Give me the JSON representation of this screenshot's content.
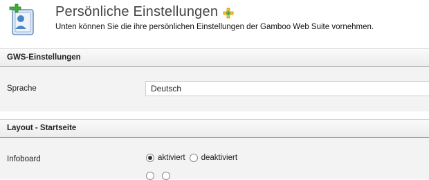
{
  "header": {
    "title": "Persönliche Einstellungen",
    "subtitle": "Unten können Sie die ihre persönlichen Einstellungen der Gamboo Web Suite vornehmen.",
    "icon": "user-settings-icon",
    "add_icon": "add-plus-icon"
  },
  "sections": [
    {
      "title": "GWS-Einstellungen",
      "fields": [
        {
          "label": "Sprache",
          "type": "select",
          "value": "Deutsch"
        }
      ]
    },
    {
      "title": "Layout - Startseite",
      "fields": [
        {
          "label": "Infoboard",
          "type": "radio",
          "options": [
            "aktiviert",
            "deaktiviert"
          ],
          "selected": "aktiviert"
        }
      ]
    }
  ],
  "colors": {
    "accent_green": "#3fae3a",
    "add_icon_yellow": "#f2c23a",
    "header_bar": "#ededed",
    "section_body": "#f3f3f3"
  }
}
